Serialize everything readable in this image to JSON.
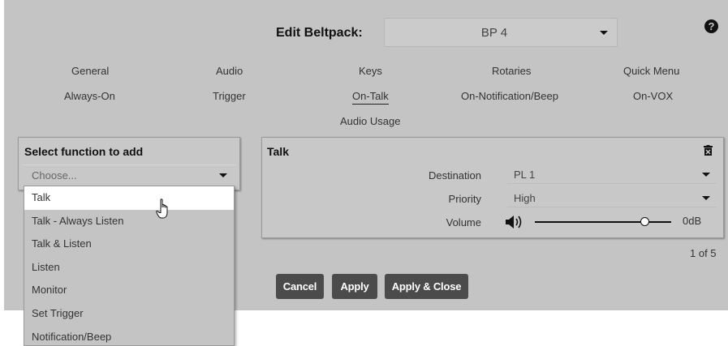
{
  "header": {
    "title": "Edit Beltpack:",
    "device_select": {
      "value": "BP 4"
    },
    "help_icon": "question-circle"
  },
  "tabs": [
    {
      "label": "General"
    },
    {
      "label": "Audio"
    },
    {
      "label": "Keys"
    },
    {
      "label": "Rotaries"
    },
    {
      "label": "Quick Menu"
    },
    {
      "label": "Always-On"
    },
    {
      "label": "Trigger"
    },
    {
      "label": "On-Talk",
      "active": true
    },
    {
      "label": "On-Notification/Beep"
    },
    {
      "label": "On-VOX"
    },
    {
      "label": "Audio Usage"
    }
  ],
  "function_selector": {
    "header": "Select function to add",
    "placeholder": "Choose...",
    "options": [
      "Talk",
      "Talk - Always Listen",
      "Talk & Listen",
      "Listen",
      "Monitor",
      "Set Trigger",
      "Notification/Beep"
    ],
    "highlighted_index": 0
  },
  "talk_card": {
    "header": "Talk",
    "destination": {
      "label": "Destination",
      "value": "PL 1"
    },
    "priority": {
      "label": "Priority",
      "value": "High"
    },
    "volume": {
      "label": "Volume",
      "value": "0dB",
      "level_fraction": 0.78
    }
  },
  "pager": "1 of 5",
  "buttons": {
    "cancel": "Cancel",
    "apply": "Apply",
    "apply_close": "Apply & Close"
  },
  "colors": {
    "panel_bg": "#c4c4c4",
    "button_bg": "#4b4b4b",
    "highlight_bg": "#ffffff"
  }
}
